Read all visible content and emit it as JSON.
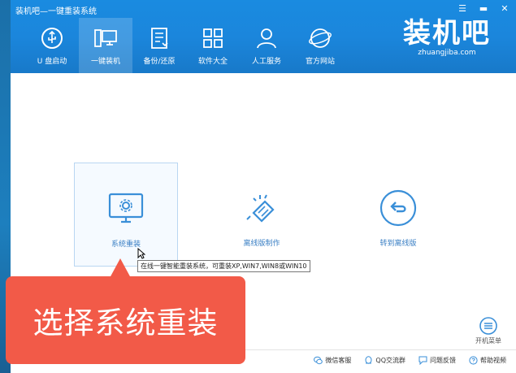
{
  "window": {
    "title": "装机吧—一键重装系统",
    "min_glyph": "▬",
    "close_glyph": "✕",
    "menu_glyph": "☰"
  },
  "nav": [
    {
      "label": "U 盘启动",
      "icon": "usb-icon"
    },
    {
      "label": "一键装机",
      "icon": "computer-icon",
      "active": true
    },
    {
      "label": "备份/还原",
      "icon": "backup-icon"
    },
    {
      "label": "软件大全",
      "icon": "grid-icon"
    },
    {
      "label": "人工服务",
      "icon": "person-icon"
    },
    {
      "label": "官方网站",
      "icon": "globe-icon"
    }
  ],
  "brand": {
    "title": "装机吧",
    "url": "zhuangjiba.com"
  },
  "options": [
    {
      "label": "系统重装",
      "icon": "monitor-gear-icon"
    },
    {
      "label": "离线版制作",
      "icon": "ethernet-plug-icon"
    },
    {
      "label": "转到离线版",
      "icon": "back-arrow-icon"
    }
  ],
  "tooltip": "在线一键智能重装系统，可重装XP,WIN7,WIN8或WIN10",
  "boot_menu": {
    "label": "开机菜单"
  },
  "footer": [
    {
      "label": "微信客服",
      "icon": "wechat-icon"
    },
    {
      "label": "QQ交流群",
      "icon": "qq-icon"
    },
    {
      "label": "问题反馈",
      "icon": "feedback-icon"
    },
    {
      "label": "帮助视频",
      "icon": "help-icon"
    }
  ],
  "callout": {
    "text": "选择系统重装"
  },
  "colors": {
    "titlebar": "#1a8be0",
    "accent": "#3a7fc4",
    "callout": "#f25a48"
  }
}
